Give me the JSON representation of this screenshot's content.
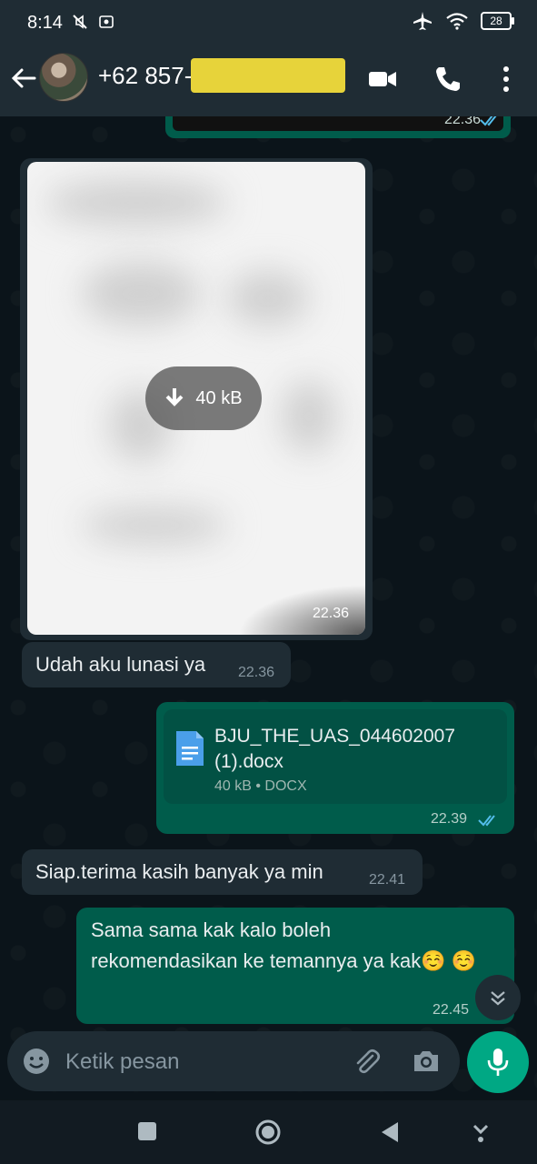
{
  "status_bar": {
    "time": "8:14",
    "battery": "28"
  },
  "header": {
    "contact_name": "+62 857-"
  },
  "messages": {
    "prev_outgoing_time": "22.36",
    "image": {
      "size": "40 kB",
      "time": "22.36"
    },
    "msg1": {
      "text": "Udah aku lunasi ya",
      "time": "22.36"
    },
    "document": {
      "name": "BJU_THE_UAS_044602007 (1).docx",
      "meta": "40 kB • DOCX",
      "time": "22.39"
    },
    "msg2": {
      "text": "Siap.terima kasih banyak ya min",
      "time": "22.41"
    },
    "msg3": {
      "text": "Sama sama kak kalo boleh rekomendasikan ke temannya ya kak☺️ ☺️",
      "time": "22.45"
    }
  },
  "composer": {
    "placeholder": "Ketik pesan"
  },
  "colors": {
    "header": "#1f2c34",
    "incoming": "#1f2c34",
    "outgoing": "#005c4b",
    "accent": "#00a884",
    "read_ticks": "#53bdeb"
  }
}
